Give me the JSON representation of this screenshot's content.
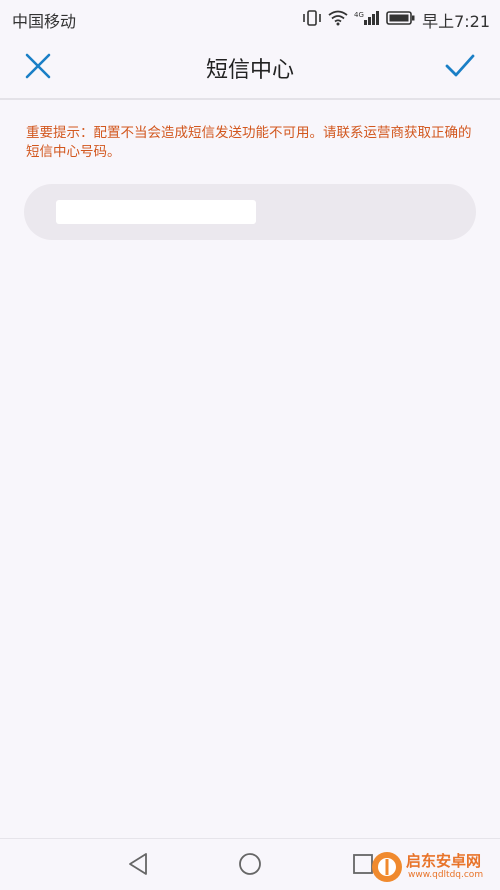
{
  "status_bar": {
    "carrier": "中国移动",
    "network": "4G",
    "time": "早上7:21"
  },
  "header": {
    "title": "短信中心",
    "close_icon": "close-icon",
    "confirm_icon": "check-icon"
  },
  "warning": {
    "text": "重要提示：配置不当会造成短信发送功能不可用。请联系运营商获取正确的短信中心号码。"
  },
  "input": {
    "value": "",
    "placeholder": ""
  },
  "nav": {
    "back_icon": "back-triangle-icon",
    "home_icon": "home-circle-icon",
    "recent_icon": "recent-square-icon"
  },
  "watermark": {
    "title": "启东安卓网",
    "url": "www.qdltdq.com"
  },
  "colors": {
    "accent": "#1a7fc6",
    "warning": "#d2571e",
    "background": "#f8f6fb"
  }
}
